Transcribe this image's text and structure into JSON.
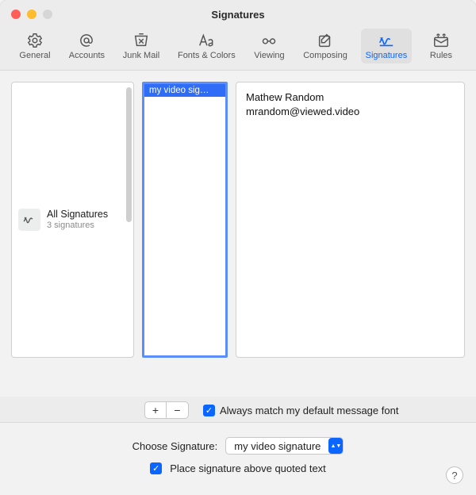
{
  "window": {
    "title": "Signatures"
  },
  "toolbar": {
    "items": [
      {
        "label": "General"
      },
      {
        "label": "Accounts"
      },
      {
        "label": "Junk Mail"
      },
      {
        "label": "Fonts & Colors"
      },
      {
        "label": "Viewing"
      },
      {
        "label": "Composing"
      },
      {
        "label": "Signatures"
      },
      {
        "label": "Rules"
      }
    ],
    "active_index": 6
  },
  "accounts": {
    "selected": {
      "name": "All Signatures",
      "subtitle": "3 signatures"
    }
  },
  "signatures": {
    "selected_label": "my video sig…"
  },
  "preview": {
    "line1": "Mathew Random",
    "line2": "mrandom@viewed.video"
  },
  "add_remove": {
    "add": "+",
    "remove": "−"
  },
  "always_match_font": {
    "checked": true,
    "label": "Always match my default message font"
  },
  "choose_signature": {
    "label": "Choose Signature:",
    "value": "my video signature"
  },
  "place_above": {
    "checked": true,
    "label": "Place signature above quoted text"
  },
  "help": "?"
}
